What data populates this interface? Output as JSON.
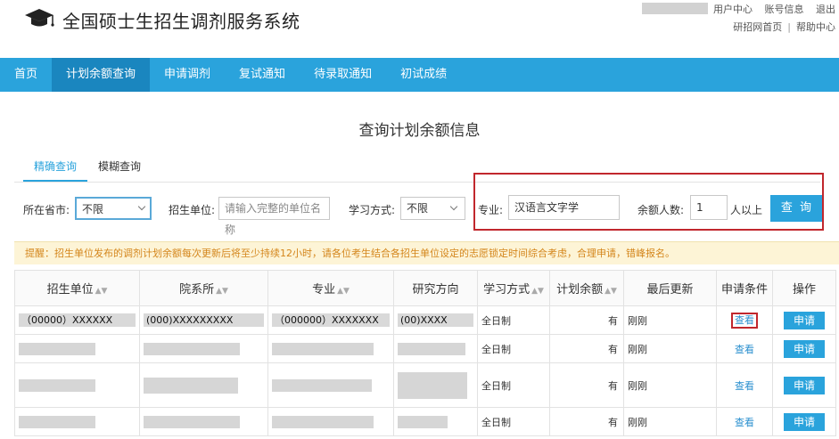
{
  "header": {
    "title": "全国硕士生招生调剂服务系统",
    "top_links": [
      "用户中心",
      "账号信息",
      "退出"
    ],
    "sub_links": [
      "研招网首页",
      "帮助中心"
    ]
  },
  "nav": [
    "首页",
    "计划余额查询",
    "申请调剂",
    "复试通知",
    "待录取通知",
    "初试成绩"
  ],
  "page_heading": "查询计划余额信息",
  "tabs": [
    "精确查询",
    "模糊查询"
  ],
  "filters": {
    "province_label": "所在省市:",
    "province_value": "不限",
    "unit_label": "招生单位:",
    "unit_placeholder": "请输入完整的单位名称",
    "mode_label": "学习方式:",
    "mode_value": "不限",
    "major_label": "专业:",
    "major_value": "汉语言文字学",
    "remain_label": "余额人数:",
    "remain_value": "1",
    "remain_suffix": "人以上",
    "query_button": "查 询"
  },
  "notice": "提醒：招生单位发布的调剂计划余额每次更新后将至少持续12小时，请各位考生结合各招生单位设定的志愿锁定时间综合考虑，合理申请，错峰报名。",
  "table": {
    "headers": [
      "招生单位",
      "院系所",
      "专业",
      "研究方向",
      "学习方式",
      "计划余额",
      "最后更新",
      "申请条件",
      "操作"
    ],
    "first_row": {
      "unit": "（00000）XXXXXX",
      "dept": "(000)XXXXXXXXX",
      "major": "（000000）XXXXXXX",
      "direction": "(00)XXXX"
    },
    "rows": [
      {
        "mode": "全日制",
        "remain": "有",
        "updated": "刚刚",
        "cond": "查看",
        "op": "申请"
      },
      {
        "mode": "全日制",
        "remain": "有",
        "updated": "刚刚",
        "cond": "查看",
        "op": "申请"
      },
      {
        "mode": "全日制",
        "remain": "有",
        "updated": "刚刚",
        "cond": "查看",
        "op": "申请"
      },
      {
        "mode": "全日制",
        "remain": "有",
        "updated": "刚刚",
        "cond": "查看",
        "op": "申请"
      }
    ]
  },
  "colors": {
    "nav": "#2aa3dc",
    "nav_active": "#1a86bf",
    "highlight_red": "#c1272d",
    "notice_text": "#d4861c"
  }
}
